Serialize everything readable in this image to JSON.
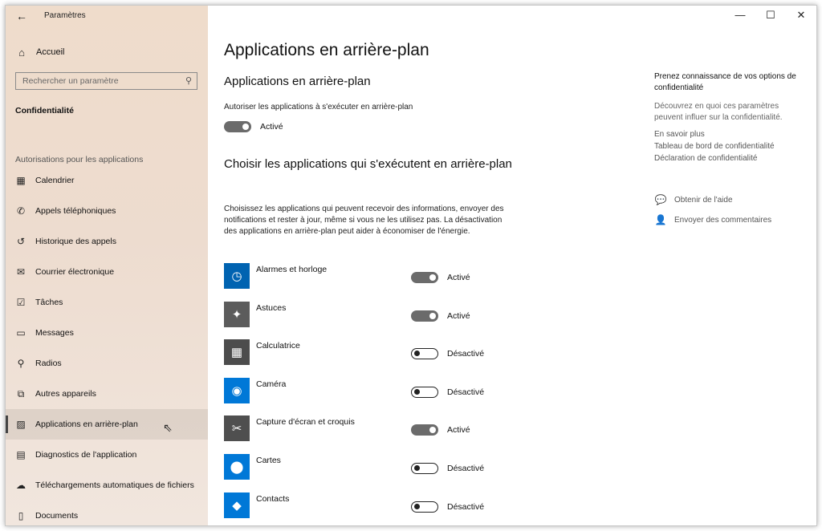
{
  "window": {
    "app_title": "Paramètres",
    "back_glyph": "←",
    "minimize_glyph": "—",
    "maximize_glyph": "☐",
    "close_glyph": "✕"
  },
  "sidebar": {
    "home_label": "Accueil",
    "search_placeholder": "Rechercher un paramètre",
    "section_title": "Confidentialité",
    "group_label": "Autorisations pour les applications",
    "items": [
      {
        "label": "Calendrier",
        "icon": "calendar-icon",
        "glyph": "▦"
      },
      {
        "label": "Appels téléphoniques",
        "icon": "phone-icon",
        "glyph": "✆"
      },
      {
        "label": "Historique des appels",
        "icon": "history-icon",
        "glyph": "↺"
      },
      {
        "label": "Courrier électronique",
        "icon": "mail-icon",
        "glyph": "✉"
      },
      {
        "label": "Tâches",
        "icon": "tasks-icon",
        "glyph": "☑"
      },
      {
        "label": "Messages",
        "icon": "message-icon",
        "glyph": "▭"
      },
      {
        "label": "Radios",
        "icon": "radio-icon",
        "glyph": "⚲"
      },
      {
        "label": "Autres appareils",
        "icon": "devices-icon",
        "glyph": "⧉"
      },
      {
        "label": "Applications en arrière-plan",
        "icon": "background-apps-icon",
        "glyph": "▨",
        "selected": true
      },
      {
        "label": "Diagnostics de l'application",
        "icon": "diagnostics-icon",
        "glyph": "▤"
      },
      {
        "label": "Téléchargements automatiques de fichiers",
        "icon": "cloud-icon",
        "glyph": "☁"
      },
      {
        "label": "Documents",
        "icon": "document-icon",
        "glyph": "▯"
      }
    ]
  },
  "main": {
    "page_title": "Applications en arrière-plan",
    "section_title": "Applications en arrière-plan",
    "allow_label": "Autoriser les applications à s'exécuter en arrière-plan",
    "allow_state": "Activé",
    "allow_on": true,
    "choose_title": "Choisir les applications qui s'exécutent en arrière-plan",
    "description": "Choisissez les applications qui peuvent recevoir des informations, envoyer des notifications et rester à jour, même si vous ne les utilisez pas. La désactivation des applications en arrière-plan peut aider à économiser de l'énergie.",
    "apps": [
      {
        "name": "Alarmes et horloge",
        "state": "Activé",
        "on": true,
        "tile_color": "#0063b1",
        "icon": "clock-icon",
        "glyph": "◷"
      },
      {
        "name": "Astuces",
        "state": "Activé",
        "on": true,
        "tile_color": "#5c5c5c",
        "icon": "lightbulb-icon",
        "glyph": "✦"
      },
      {
        "name": "Calculatrice",
        "state": "Désactivé",
        "on": false,
        "tile_color": "#4c4c4c",
        "icon": "calculator-icon",
        "glyph": "▦"
      },
      {
        "name": "Caméra",
        "state": "Désactivé",
        "on": false,
        "tile_color": "#0078d7",
        "icon": "camera-icon",
        "glyph": "◉"
      },
      {
        "name": "Capture d'écran et croquis",
        "state": "Activé",
        "on": true,
        "tile_color": "#4f4f4f",
        "icon": "snip-sketch-icon",
        "glyph": "✂"
      },
      {
        "name": "Cartes",
        "state": "Désactivé",
        "on": false,
        "tile_color": "#0078d7",
        "icon": "map-pin-icon",
        "glyph": "⬤"
      },
      {
        "name": "Contacts",
        "state": "Désactivé",
        "on": false,
        "tile_color": "#0078d7",
        "icon": "contacts-icon",
        "glyph": "◆"
      }
    ]
  },
  "right_panel": {
    "title": "Prenez connaissance de vos options de confidentialité",
    "description": "Découvrez en quoi ces paramètres peuvent influer sur la confidentialité.",
    "links": [
      "En savoir plus",
      "Tableau de bord de confidentialité",
      "Déclaration de confidentialité"
    ],
    "help_label": "Obtenir de l'aide",
    "feedback_label": "Envoyer des commentaires"
  }
}
